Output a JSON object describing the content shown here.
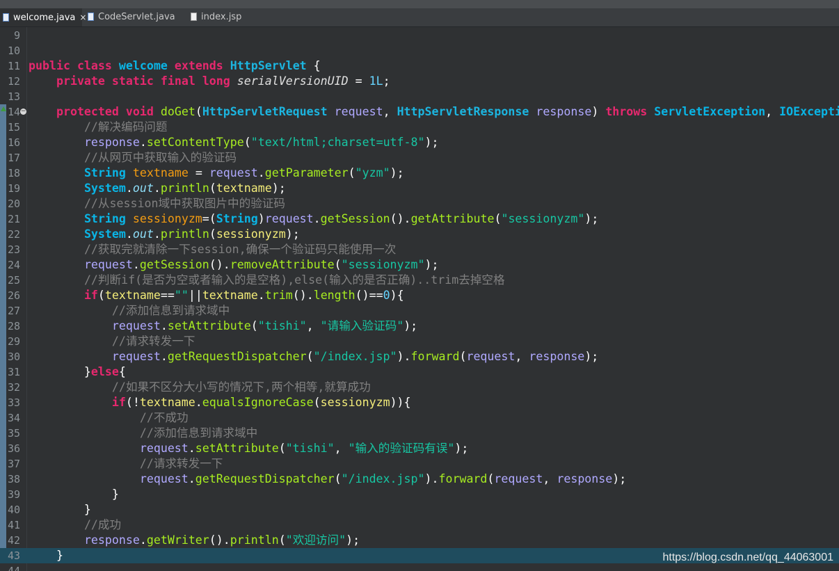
{
  "tabs": [
    {
      "label": "welcome.java",
      "active": true,
      "close": "×"
    },
    {
      "label": "CodeServlet.java",
      "active": false
    },
    {
      "label": "index.jsp",
      "active": false
    }
  ],
  "lines": [
    {
      "n": "9",
      "t": []
    },
    {
      "n": "10",
      "t": []
    },
    {
      "n": "11",
      "t": [
        [
          "kw",
          "public"
        ],
        [
          "pl",
          " "
        ],
        [
          "kw",
          "class"
        ],
        [
          "pl",
          " "
        ],
        [
          "tp",
          "welcome"
        ],
        [
          "pl",
          " "
        ],
        [
          "kw",
          "extends"
        ],
        [
          "pl",
          " "
        ],
        [
          "cls",
          "HttpServlet"
        ],
        [
          "pl",
          " {"
        ]
      ]
    },
    {
      "n": "12",
      "t": [
        [
          "pl",
          "    "
        ],
        [
          "kw",
          "private"
        ],
        [
          "pl",
          " "
        ],
        [
          "kw",
          "static"
        ],
        [
          "pl",
          " "
        ],
        [
          "kw",
          "final"
        ],
        [
          "pl",
          " "
        ],
        [
          "kw",
          "long"
        ],
        [
          "pl",
          " "
        ],
        [
          "it",
          "serialVersionUID"
        ],
        [
          "pl",
          " = "
        ],
        [
          "num",
          "1L"
        ],
        [
          "pl",
          ";"
        ]
      ]
    },
    {
      "n": "13",
      "t": []
    },
    {
      "n": "14",
      "fold": true,
      "ovr": true,
      "t": [
        [
          "pl",
          "    "
        ],
        [
          "kw",
          "protected"
        ],
        [
          "pl",
          " "
        ],
        [
          "kw",
          "void"
        ],
        [
          "pl",
          " "
        ],
        [
          "fn",
          "doGet"
        ],
        [
          "pl",
          "("
        ],
        [
          "cls",
          "HttpServletRequest"
        ],
        [
          "pl",
          " "
        ],
        [
          "prm",
          "request"
        ],
        [
          "pl",
          ", "
        ],
        [
          "cls",
          "HttpServletResponse"
        ],
        [
          "pl",
          " "
        ],
        [
          "prm",
          "response"
        ],
        [
          "pl",
          ") "
        ],
        [
          "kw",
          "throws"
        ],
        [
          "pl",
          " "
        ],
        [
          "tp",
          "ServletException"
        ],
        [
          "pl",
          ", "
        ],
        [
          "tp",
          "IOExcepti"
        ]
      ]
    },
    {
      "n": "15",
      "t": [
        [
          "pl",
          "        "
        ],
        [
          "cm",
          "//解决编码问题"
        ]
      ]
    },
    {
      "n": "16",
      "t": [
        [
          "pl",
          "        "
        ],
        [
          "prm",
          "response"
        ],
        [
          "pl",
          "."
        ],
        [
          "fn",
          "setContentType"
        ],
        [
          "pl",
          "("
        ],
        [
          "str",
          "\"text/html;charset=utf-8\""
        ],
        [
          "pl",
          ");"
        ]
      ]
    },
    {
      "n": "17",
      "t": [
        [
          "pl",
          "        "
        ],
        [
          "cm",
          "//从网页中获取输入的验证码"
        ]
      ]
    },
    {
      "n": "18",
      "t": [
        [
          "pl",
          "        "
        ],
        [
          "tp",
          "String"
        ],
        [
          "pl",
          " "
        ],
        [
          "loc",
          "textname"
        ],
        [
          "pl",
          " = "
        ],
        [
          "prm",
          "request"
        ],
        [
          "pl",
          "."
        ],
        [
          "fn",
          "getParameter"
        ],
        [
          "pl",
          "("
        ],
        [
          "str",
          "\"yzm\""
        ],
        [
          "pl",
          ");"
        ]
      ]
    },
    {
      "n": "19",
      "t": [
        [
          "pl",
          "        "
        ],
        [
          "tp",
          "System"
        ],
        [
          "pl",
          "."
        ],
        [
          "fld",
          "out"
        ],
        [
          "pl",
          "."
        ],
        [
          "fn",
          "println"
        ],
        [
          "pl",
          "("
        ],
        [
          "var",
          "textname"
        ],
        [
          "pl",
          ");"
        ]
      ]
    },
    {
      "n": "20",
      "t": [
        [
          "pl",
          "        "
        ],
        [
          "cm",
          "//从session域中获取图片中的验证码"
        ]
      ]
    },
    {
      "n": "21",
      "t": [
        [
          "pl",
          "        "
        ],
        [
          "tp",
          "String"
        ],
        [
          "pl",
          " "
        ],
        [
          "loc",
          "sessionyzm"
        ],
        [
          "pl",
          "=("
        ],
        [
          "tp",
          "String"
        ],
        [
          "pl",
          ")"
        ],
        [
          "prm",
          "request"
        ],
        [
          "pl",
          "."
        ],
        [
          "fn",
          "getSession"
        ],
        [
          "pl",
          "()."
        ],
        [
          "fn",
          "getAttribute"
        ],
        [
          "pl",
          "("
        ],
        [
          "str",
          "\"sessionyzm\""
        ],
        [
          "pl",
          ");"
        ]
      ]
    },
    {
      "n": "22",
      "t": [
        [
          "pl",
          "        "
        ],
        [
          "tp",
          "System"
        ],
        [
          "pl",
          "."
        ],
        [
          "fld",
          "out"
        ],
        [
          "pl",
          "."
        ],
        [
          "fn",
          "println"
        ],
        [
          "pl",
          "("
        ],
        [
          "var",
          "sessionyzm"
        ],
        [
          "pl",
          ");"
        ]
      ]
    },
    {
      "n": "23",
      "t": [
        [
          "pl",
          "        "
        ],
        [
          "cm",
          "//获取完就清除一下session,确保一个验证码只能使用一次"
        ]
      ]
    },
    {
      "n": "24",
      "t": [
        [
          "pl",
          "        "
        ],
        [
          "prm",
          "request"
        ],
        [
          "pl",
          "."
        ],
        [
          "fn",
          "getSession"
        ],
        [
          "pl",
          "()."
        ],
        [
          "fn",
          "removeAttribute"
        ],
        [
          "pl",
          "("
        ],
        [
          "str",
          "\"sessionyzm\""
        ],
        [
          "pl",
          ");"
        ]
      ]
    },
    {
      "n": "25",
      "t": [
        [
          "pl",
          "        "
        ],
        [
          "cm",
          "//判断if(是否为空或者输入的是空格),else(输入的是否正确)..trim去掉空格"
        ]
      ]
    },
    {
      "n": "26",
      "t": [
        [
          "pl",
          "        "
        ],
        [
          "kw",
          "if"
        ],
        [
          "pl",
          "("
        ],
        [
          "var",
          "textname"
        ],
        [
          "pl",
          "=="
        ],
        [
          "str",
          "\"\""
        ],
        [
          "pl",
          "||"
        ],
        [
          "var",
          "textname"
        ],
        [
          "pl",
          "."
        ],
        [
          "fn",
          "trim"
        ],
        [
          "pl",
          "()."
        ],
        [
          "fn",
          "length"
        ],
        [
          "pl",
          "()=="
        ],
        [
          "num",
          "0"
        ],
        [
          "pl",
          "){"
        ]
      ]
    },
    {
      "n": "27",
      "t": [
        [
          "pl",
          "            "
        ],
        [
          "cm",
          "//添加信息到请求域中"
        ]
      ]
    },
    {
      "n": "28",
      "t": [
        [
          "pl",
          "            "
        ],
        [
          "prm",
          "request"
        ],
        [
          "pl",
          "."
        ],
        [
          "fn",
          "setAttribute"
        ],
        [
          "pl",
          "("
        ],
        [
          "str",
          "\"tishi\""
        ],
        [
          "pl",
          ", "
        ],
        [
          "str",
          "\"请输入验证码\""
        ],
        [
          "pl",
          ");"
        ]
      ]
    },
    {
      "n": "29",
      "t": [
        [
          "pl",
          "            "
        ],
        [
          "cm",
          "//请求转发一下"
        ]
      ]
    },
    {
      "n": "30",
      "t": [
        [
          "pl",
          "            "
        ],
        [
          "prm",
          "request"
        ],
        [
          "pl",
          "."
        ],
        [
          "fn",
          "getRequestDispatcher"
        ],
        [
          "pl",
          "("
        ],
        [
          "str",
          "\"/index.jsp\""
        ],
        [
          "pl",
          ")."
        ],
        [
          "fn",
          "forward"
        ],
        [
          "pl",
          "("
        ],
        [
          "prm",
          "request"
        ],
        [
          "pl",
          ", "
        ],
        [
          "prm",
          "response"
        ],
        [
          "pl",
          ");"
        ]
      ]
    },
    {
      "n": "31",
      "t": [
        [
          "pl",
          "        }"
        ],
        [
          "kw",
          "else"
        ],
        [
          "pl",
          "{"
        ]
      ]
    },
    {
      "n": "32",
      "t": [
        [
          "pl",
          "            "
        ],
        [
          "cm",
          "//如果不区分大小写的情况下,两个相等,就算成功"
        ]
      ]
    },
    {
      "n": "33",
      "t": [
        [
          "pl",
          "            "
        ],
        [
          "kw",
          "if"
        ],
        [
          "pl",
          "(!"
        ],
        [
          "var",
          "textname"
        ],
        [
          "pl",
          "."
        ],
        [
          "fn",
          "equalsIgnoreCase"
        ],
        [
          "pl",
          "("
        ],
        [
          "var",
          "sessionyzm"
        ],
        [
          "pl",
          ")){"
        ]
      ]
    },
    {
      "n": "34",
      "t": [
        [
          "pl",
          "                "
        ],
        [
          "cm",
          "//不成功"
        ]
      ]
    },
    {
      "n": "35",
      "t": [
        [
          "pl",
          "                "
        ],
        [
          "cm",
          "//添加信息到请求域中"
        ]
      ]
    },
    {
      "n": "36",
      "t": [
        [
          "pl",
          "                "
        ],
        [
          "prm",
          "request"
        ],
        [
          "pl",
          "."
        ],
        [
          "fn",
          "setAttribute"
        ],
        [
          "pl",
          "("
        ],
        [
          "str",
          "\"tishi\""
        ],
        [
          "pl",
          ", "
        ],
        [
          "str",
          "\"输入的验证码有误\""
        ],
        [
          "pl",
          ");"
        ]
      ]
    },
    {
      "n": "37",
      "t": [
        [
          "pl",
          "                "
        ],
        [
          "cm",
          "//请求转发一下"
        ]
      ]
    },
    {
      "n": "38",
      "t": [
        [
          "pl",
          "                "
        ],
        [
          "prm",
          "request"
        ],
        [
          "pl",
          "."
        ],
        [
          "fn",
          "getRequestDispatcher"
        ],
        [
          "pl",
          "("
        ],
        [
          "str",
          "\"/index.jsp\""
        ],
        [
          "pl",
          ")."
        ],
        [
          "fn",
          "forward"
        ],
        [
          "pl",
          "("
        ],
        [
          "prm",
          "request"
        ],
        [
          "pl",
          ", "
        ],
        [
          "prm",
          "response"
        ],
        [
          "pl",
          ");"
        ]
      ]
    },
    {
      "n": "39",
      "t": [
        [
          "pl",
          "            }"
        ]
      ]
    },
    {
      "n": "40",
      "t": [
        [
          "pl",
          "        }"
        ]
      ]
    },
    {
      "n": "41",
      "t": [
        [
          "pl",
          "        "
        ],
        [
          "cm",
          "//成功"
        ]
      ]
    },
    {
      "n": "42",
      "t": [
        [
          "pl",
          "        "
        ],
        [
          "prm",
          "response"
        ],
        [
          "pl",
          "."
        ],
        [
          "fn",
          "getWriter"
        ],
        [
          "pl",
          "()."
        ],
        [
          "fn",
          "println"
        ],
        [
          "pl",
          "("
        ],
        [
          "str",
          "\"欢迎访问\""
        ],
        [
          "pl",
          ");"
        ]
      ]
    },
    {
      "n": "43",
      "current": true,
      "t": [
        [
          "pl",
          "    }"
        ]
      ]
    },
    {
      "n": "44",
      "t": []
    }
  ],
  "watermark": "https://blog.csdn.net/qq_44063001"
}
